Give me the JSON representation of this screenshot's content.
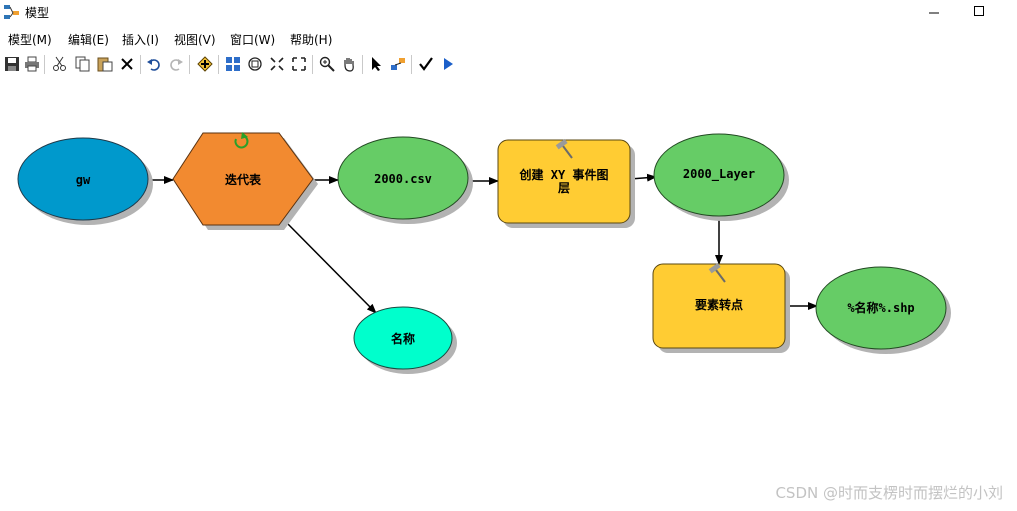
{
  "window": {
    "title": "模型"
  },
  "menu": [
    "模型(M)",
    "编辑(E)",
    "插入(I)",
    "视图(V)",
    "窗口(W)",
    "帮助(H)"
  ],
  "toolbar": [
    {
      "name": "save-icon"
    },
    {
      "name": "print-icon"
    },
    {
      "name": "cut-icon"
    },
    {
      "name": "copy-icon"
    },
    {
      "name": "paste-icon"
    },
    {
      "name": "delete-icon"
    },
    {
      "name": "undo-icon"
    },
    {
      "name": "redo-icon"
    },
    {
      "name": "add-data-icon"
    },
    {
      "name": "auto-layout-icon"
    },
    {
      "name": "full-extent-icon"
    },
    {
      "name": "fixed-zoom-in-icon"
    },
    {
      "name": "fixed-zoom-out-icon"
    },
    {
      "name": "zoom-icon"
    },
    {
      "name": "pan-icon"
    },
    {
      "name": "select-icon"
    },
    {
      "name": "connect-icon"
    },
    {
      "name": "validate-icon"
    },
    {
      "name": "run-icon"
    }
  ],
  "model": {
    "nodes": {
      "gw": {
        "label": "gw",
        "color": "#0099CC"
      },
      "iterator": {
        "label": "迭代表",
        "color": "#F28A30"
      },
      "csv": {
        "label": "2000.csv",
        "color": "#66CC66"
      },
      "xy_tool": {
        "label1": "创建 XY 事件图",
        "label2": "层",
        "color": "#FFCC33"
      },
      "layer": {
        "label": "2000_Layer",
        "color": "#66CC66"
      },
      "name": {
        "label": "名称",
        "color": "#00FFCC"
      },
      "feature_tool": {
        "label": "要素转点",
        "color": "#FFCC33"
      },
      "output": {
        "label": "%名称%.shp",
        "color": "#66CC66"
      }
    }
  },
  "watermark": "CSDN @时而支楞时而摆烂的小刘"
}
